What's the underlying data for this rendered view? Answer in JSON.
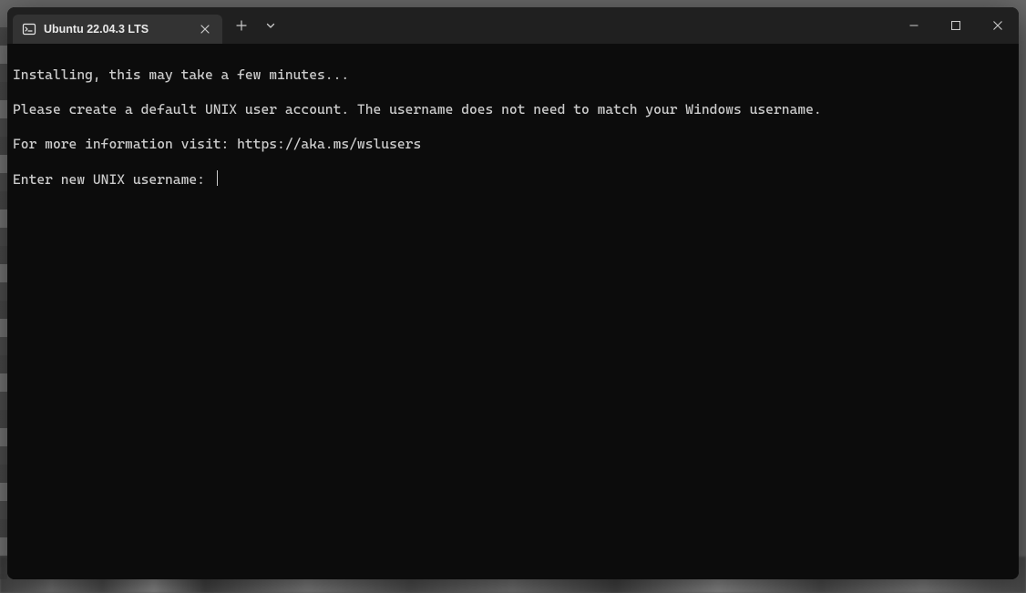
{
  "tab": {
    "title": "Ubuntu 22.04.3 LTS",
    "icon_name": "terminal-icon"
  },
  "terminal": {
    "lines": [
      "Installing, this may take a few minutes...",
      "Please create a default UNIX user account. The username does not need to match your Windows username.",
      "For more information visit: https://aka.ms/wslusers"
    ],
    "prompt": "Enter new UNIX username: ",
    "input_value": ""
  }
}
